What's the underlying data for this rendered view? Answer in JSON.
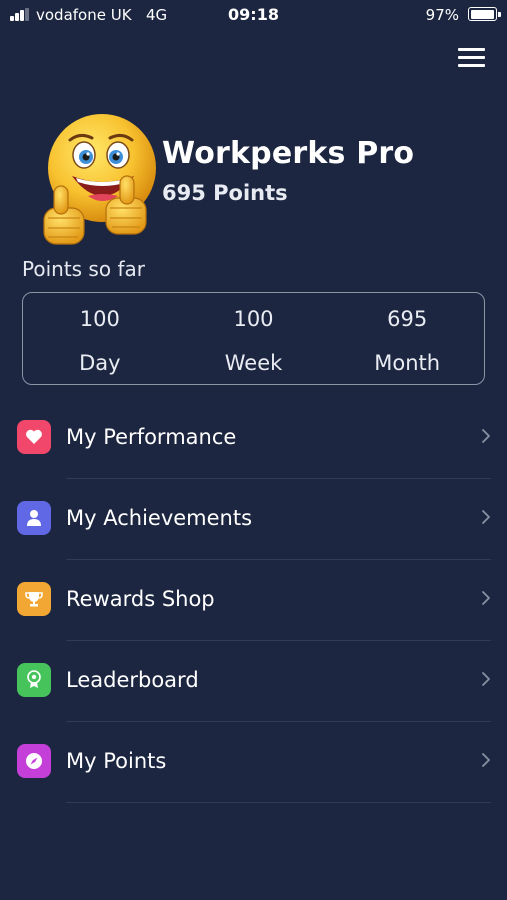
{
  "status_bar": {
    "carrier": "vodafone UK",
    "network": "4G",
    "time": "09:18",
    "battery_percent": "97%",
    "battery_level": 0.97,
    "signal_bars": 3
  },
  "header": {
    "menu_icon": "hamburger-menu-icon",
    "avatar_icon": "thumbs-up-emoji"
  },
  "profile": {
    "name": "Workperks Pro",
    "points": "695 Points"
  },
  "points_summary": {
    "label": "Points so far",
    "stats": [
      {
        "value": "100",
        "label": "Day"
      },
      {
        "value": "100",
        "label": "Week"
      },
      {
        "value": "695",
        "label": "Month"
      }
    ]
  },
  "menu": {
    "items": [
      {
        "label": "My Performance",
        "icon": "heart-icon",
        "color": "#f0476b"
      },
      {
        "label": "My Achievements",
        "icon": "person-icon",
        "color": "#6168e6"
      },
      {
        "label": "Rewards Shop",
        "icon": "trophy-icon",
        "color": "#f2a633"
      },
      {
        "label": "Leaderboard",
        "icon": "leaderboard-icon",
        "color": "#46c45b"
      },
      {
        "label": "My Points",
        "icon": "compass-icon",
        "color": "#c33fd7"
      }
    ]
  },
  "colors": {
    "background": "#1c2640",
    "card_border": "#8d94a6",
    "divider": "#313b55",
    "chevron": "#8a91a3"
  }
}
